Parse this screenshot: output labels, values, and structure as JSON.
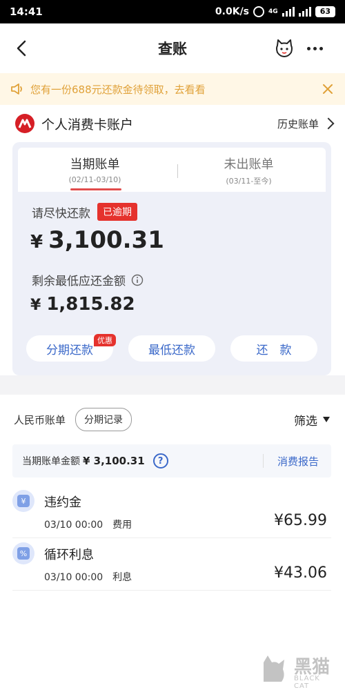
{
  "status_bar": {
    "time": "14:41",
    "net_speed": "0.0K/s",
    "network_type": "4G",
    "battery": "63"
  },
  "nav": {
    "title": "查账",
    "back_icon": "chevron-left-icon",
    "cat_icon": "cat-icon",
    "more_icon": "more-dots-icon"
  },
  "banner": {
    "text": "您有一份688元还款金待领取，去看看",
    "icon": "speaker-icon",
    "close_icon": "close-icon",
    "color": "#e0a138"
  },
  "account": {
    "title": "个人消费卡账户",
    "history_label": "历史账单",
    "logo_color": "#d61f26"
  },
  "tabs": [
    {
      "label": "当期账单",
      "range": "(02/11-03/10)",
      "active": true
    },
    {
      "label": "未出账单",
      "range": "(03/11-至今)",
      "active": false
    }
  ],
  "due": {
    "label": "请尽快还款",
    "badge": "已逾期",
    "currency": "¥",
    "amount": "3,100.31"
  },
  "minimum": {
    "label": "剩余最低应还金额",
    "currency": "¥",
    "amount": "1,815.82"
  },
  "actions": {
    "installment": "分期还款",
    "promo_badge": "优惠",
    "minimum_pay": "最低还款",
    "repay": "还　款"
  },
  "bill": {
    "currency_tab": "人民币账单",
    "installment_record": "分期记录",
    "filter_label": "筛选",
    "summary_label": "当期账单金额",
    "summary_amount": "¥ 3,100.31",
    "help_glyph": "?",
    "report_label": "消费报告"
  },
  "transactions": [
    {
      "name": "违约金",
      "datetime": "03/10 00:00",
      "category": "费用",
      "amount": "¥65.99",
      "icon": "yen-icon",
      "glyph": "¥"
    },
    {
      "name": "循环利息",
      "datetime": "03/10 00:00",
      "category": "利息",
      "amount": "¥43.06",
      "icon": "percent-icon",
      "glyph": "%"
    }
  ],
  "watermark": {
    "text": "黑猫",
    "sub": "BLACK CAT"
  },
  "colors": {
    "accent_blue": "#3a68c9",
    "alert_red": "#e5322d",
    "card_bg": "#eef0f8"
  }
}
